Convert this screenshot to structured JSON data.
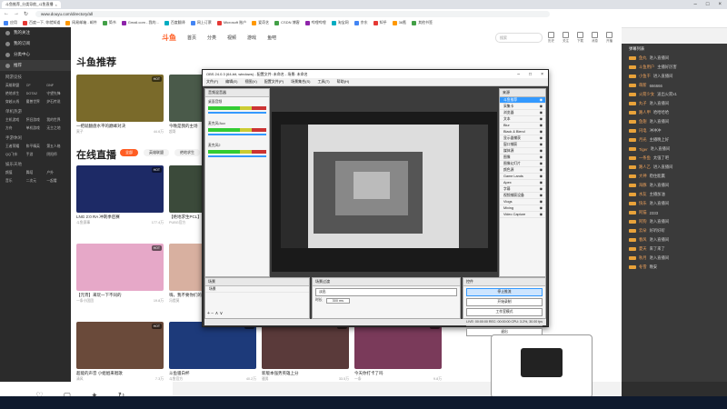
{
  "browser": {
    "tab_title": "斗鱼推荐_分类导航_斗鱼直播",
    "address": "www.douyu.com/directory/all",
    "bookmarks": [
      "应用",
      "百度一下, 你就知道",
      "网易邮箱 - 邮件",
      "简书",
      "Gmail.com - 我的...",
      "百度翻译",
      "网上订票",
      "Microsoft 账户",
      "爱奇艺",
      "CSDN 博客",
      "哔哩哔哩",
      "淘宝网",
      "京东",
      "知乎",
      "36氪",
      "其他书签"
    ]
  },
  "site": {
    "logo": "斗鱼",
    "nav": [
      "首页",
      "分类",
      "视频",
      "游戏",
      "鱼吧"
    ],
    "search_placeholder": "搜索",
    "header_icons": [
      "历史",
      "关注",
      "下载",
      "消息",
      "开播"
    ]
  },
  "sidebar": {
    "top_items": [
      "我的关注",
      "我的订阅",
      "分类中心"
    ],
    "hot_label": "推荐",
    "sections": [
      {
        "title": "网游竞技",
        "items": [
          "英雄联盟",
          "CF",
          "DNF",
          "绝地求生",
          "DOTA2",
          "守望先锋",
          "穿越火线",
          "魔兽世界",
          "炉石传说"
        ]
      },
      {
        "title": "单机热游",
        "items": [
          "主机游戏",
          "怀旧游戏",
          "我的世界",
          "方舟",
          "单机游戏",
          "无主之地"
        ]
      },
      {
        "title": "手游休闲",
        "items": [
          "王者荣耀",
          "和平精英",
          "第五人格",
          "QQ飞车",
          "手游",
          "阴阳师"
        ]
      },
      {
        "title": "娱乐天地",
        "items": [
          "颜值",
          "舞蹈",
          "户外",
          "音乐",
          "二次元",
          "一起看"
        ]
      }
    ]
  },
  "main": {
    "recommend_title": "斗鱼推荐",
    "live_title": "在线直播",
    "filter_chips": [
      "全部",
      "英雄联盟",
      "绝地求生"
    ],
    "cards_top": [
      {
        "title": "一把就翻盘水平的巅峰对决",
        "meta_left": "寅子",
        "meta_right": "44.6万",
        "color": "#7a6a2a"
      },
      {
        "title": "今晚是我的主场",
        "meta_left": "超哥",
        "meta_right": "12.3万",
        "color": "#4a5a4a"
      },
      {
        "title": "LPL赛事直播",
        "meta_left": "斗鱼赛事",
        "meta_right": "96.5万",
        "color": "#2f3a55"
      },
      {
        "title": "我来这里就是为了你们",
        "meta_left": "小团团",
        "meta_right": "30.1万",
        "color": "#6a4a5a"
      }
    ],
    "cards_mid": [
      {
        "title": "LNG 2:0 RA 冲刺季后赛",
        "meta_left": "斗鱼赛事",
        "meta_right": "177.4万",
        "color": "#1d2a66"
      },
      {
        "title": "【绝地求生PCL】今日精彩",
        "meta_left": "PUBG官方",
        "meta_right": "32.6万",
        "color": "#3b4a3a"
      },
      {
        "title": "第一视角团战",
        "meta_left": "旭旭宝宝",
        "meta_right": "58.2万",
        "color": "#5a4e2a"
      },
      {
        "title": "一刀999",
        "meta_left": "药水哥",
        "meta_right": "21.9万",
        "color": "#5a3838"
      }
    ],
    "cards_low": [
      {
        "title": "【元宵】来玩一下不同的",
        "meta_left": "一条小团团",
        "meta_right": "19.8万",
        "color": "#e6a8c8"
      },
      {
        "title": "嗨，我不要你们的火箭",
        "meta_left": "冯提莫",
        "meta_right": "25.1万",
        "color": "#d8b0a0"
      },
      {
        "title": "官方赛事直播间",
        "meta_left": "斗鱼官方",
        "meta_right": "11.2万",
        "color": "#2f4f7f"
      },
      {
        "title": "今天也要元气满满",
        "meta_left": "周淑怡",
        "meta_right": "16.4万",
        "color": "#c87f9a"
      }
    ],
    "cards_bottom": [
      {
        "title": "超能的声音 小姐姐来唱歌",
        "meta_left": "清风",
        "meta_right": "7.3万",
        "color": "#6a4a3a"
      },
      {
        "title": "斗鱼骚白杯",
        "meta_left": "斗鱼官方",
        "meta_right": "40.2万",
        "color": "#1d3a7a"
      },
      {
        "title": "新版本强势英雄上分",
        "meta_left": "骚男",
        "meta_right": "33.5万",
        "color": "#5a3a3a"
      },
      {
        "title": "今天你打卡了吗",
        "meta_left": "一条",
        "meta_right": "9.8万",
        "color": "#7a3a5a"
      }
    ]
  },
  "obs": {
    "title": "OBS 24.0.3 (64-bit, windows) - 配置文件: 未命名 - 场景: 未命名",
    "menu": [
      "文件(F)",
      "编辑(E)",
      "视图(V)",
      "配置文件(P)",
      "场景集合(S)",
      "工具(T)",
      "帮助(H)"
    ],
    "mixer_title": "音频混音器",
    "mixer_channels": [
      "桌面音频",
      "麦克风/Aux",
      "麦克风2"
    ],
    "scenes_title": "场景",
    "scene_item": "场景",
    "sources_title": "来源",
    "sources": [
      "斗鱼推荐",
      "采集卡",
      "浏览器",
      "文本",
      "Blur",
      "Black & Blend",
      "显示器捕获",
      "窗口捕获",
      "媒体源",
      "图像",
      "图像幻灯片",
      "颜色源",
      "Game Lands",
      "Apex",
      "字幕",
      "视频捕获设备",
      "Vlogs",
      "Mixing",
      "Video Capture"
    ],
    "transitions_title": "场景过渡",
    "transition_type": "淡出",
    "duration_label": "时长",
    "duration_value": "300 ms",
    "controls_title": "控件",
    "controls": [
      "停止推流",
      "开始录制",
      "工作室模式",
      "设置",
      "退出"
    ],
    "status": "LIVE: 00:00:00  REC: 00:00:00  CPU: 3.2%, 30.00 fps"
  },
  "chat": {
    "header": "弹幕列表",
    "messages": [
      {
        "user": "鱼丸",
        "text": "进入直播间"
      },
      {
        "user": "斗鱼用户",
        "text": "主播好厉害"
      },
      {
        "user": "小鱼干",
        "text": "进入直播间"
      },
      {
        "user": "萌新",
        "text": "666666"
      },
      {
        "user": "火箭少女",
        "text": "送出火箭x1"
      },
      {
        "user": "丸子",
        "text": "进入直播间"
      },
      {
        "user": "路人甲",
        "text": "哈哈哈哈"
      },
      {
        "user": "鱼翅",
        "text": "进入直播间"
      },
      {
        "user": "闪电",
        "text": "冲冲冲"
      },
      {
        "user": "月光",
        "text": "主播晚上好"
      },
      {
        "user": "Tiger",
        "text": "进入直播间"
      },
      {
        "user": "一条鱼",
        "text": "太强了吧"
      },
      {
        "user": "路人乙",
        "text": "进入直播间"
      },
      {
        "user": "大神",
        "text": "稳住能赢"
      },
      {
        "user": "海豚",
        "text": "进入直播间"
      },
      {
        "user": "水友",
        "text": "主播加油"
      },
      {
        "user": "快乐",
        "text": "进入直播间"
      },
      {
        "user": "阿猫",
        "text": "2333"
      },
      {
        "user": "阿狗",
        "text": "进入直播间"
      },
      {
        "user": "云朵",
        "text": "好听好听"
      },
      {
        "user": "春风",
        "text": "进入直播间"
      },
      {
        "user": "夏天",
        "text": "来了来了"
      },
      {
        "user": "秋月",
        "text": "进入直播间"
      },
      {
        "user": "冬雪",
        "text": "晚安"
      }
    ]
  },
  "bottom_bar": {
    "icons": [
      "chevron-down",
      "heart",
      "box",
      "gift",
      "refresh"
    ]
  },
  "colors": {
    "brand": "#ff5d23",
    "sidebar": "#2b2b2b",
    "chat_bg": "#3a3a3a",
    "obs_bg": "#3c3c3c"
  }
}
